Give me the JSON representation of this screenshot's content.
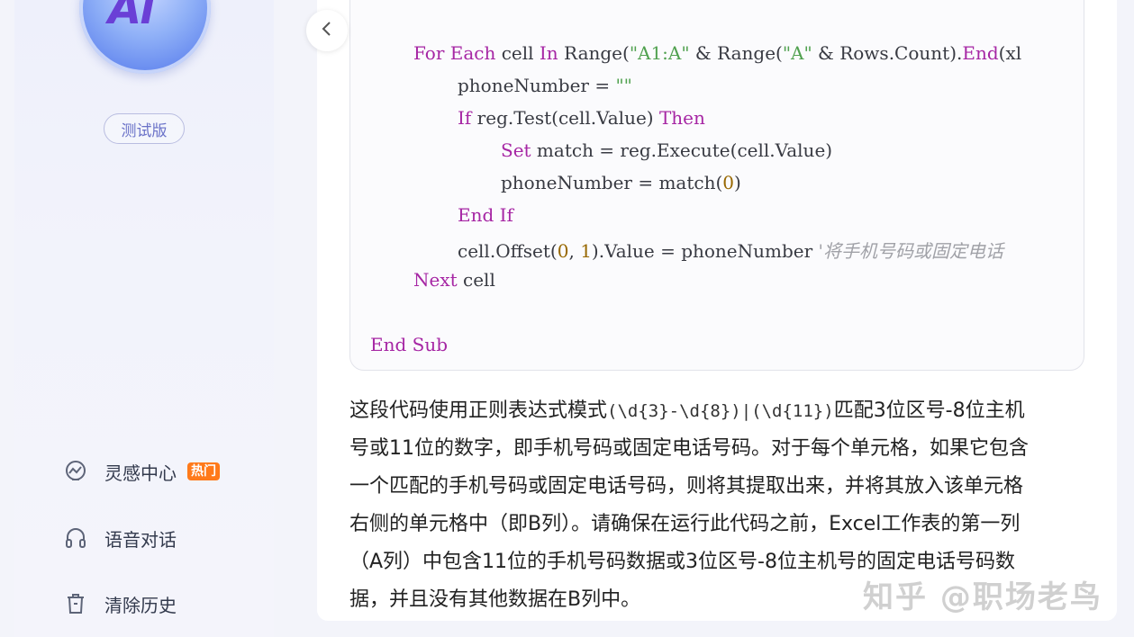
{
  "sidebar": {
    "logo_text": "Ai",
    "beta_label": "测试版",
    "nav": [
      {
        "label": "灵感中心",
        "icon": "inspiration-icon",
        "tag": "热门"
      },
      {
        "label": "语音对话",
        "icon": "headphones-icon"
      },
      {
        "label": "清除历史",
        "icon": "trash-icon"
      }
    ]
  },
  "code": {
    "language": "VBA",
    "lines": [
      "For Each cell In Range(\"A1:A\" & Range(\"A\" & Rows.Count).End(xl",
      "phoneNumber = \"\"",
      "If reg.Test(cell.Value) Then",
      "Set match = reg.Execute(cell.Value)",
      "phoneNumber = match(0)",
      "End If",
      "cell.Offset(0, 1).Value = phoneNumber '将手机号码或固定电话",
      "Next cell",
      "End Sub"
    ]
  },
  "explanation": {
    "lines": [
      "这段代码使用正则表达式模式",
      "(\\d{3}-\\d{8})|(\\d{11})",
      "匹配3位区号-8位主机",
      "号或11位的数字，即手机号码或固定电话号码。对于每个单元格，如果它包含",
      "一个匹配的手机号码或固定电话号码，则将其提取出来，并将其放入该单元格",
      "右侧的单元格中（即B列）。请确保在运行此代码之前，Excel工作表的第一列",
      "（A列）中包含11位的手机号码数据或3位区号-8位主机号的固定电话号码数",
      "据，并且没有其他数据在B列中。"
    ]
  },
  "watermark": "知乎 @职场老鸟",
  "colors": {
    "keyword": "#a626a4",
    "string": "#50a14f",
    "number": "#986801",
    "comment": "#a0a1a7",
    "hot_tag": "#ff7a1a"
  }
}
